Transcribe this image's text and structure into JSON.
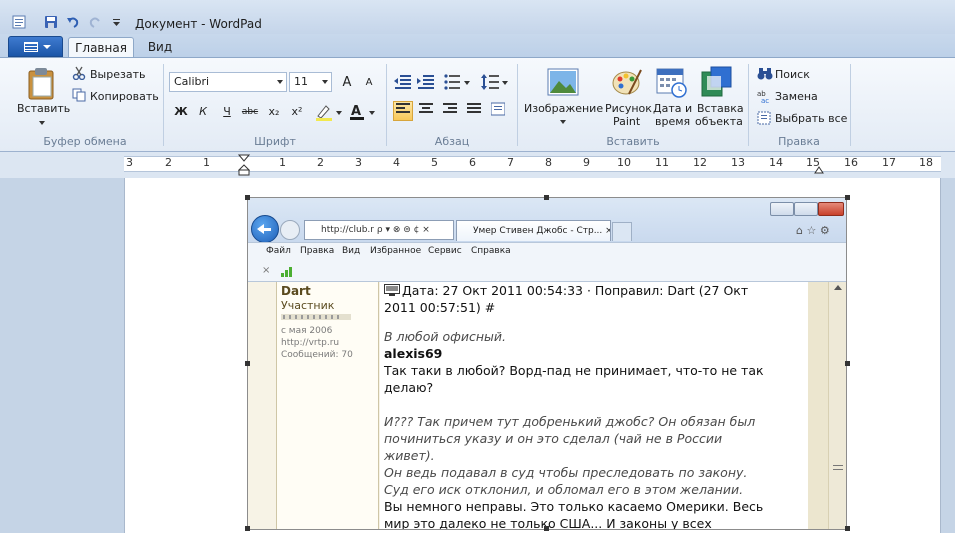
{
  "window": {
    "title": "Документ - WordPad"
  },
  "tabs": [
    {
      "label": "Главная"
    },
    {
      "label": "Вид"
    }
  ],
  "clipboard": {
    "paste": "Вставить",
    "cut": "Вырезать",
    "copy": "Копировать",
    "group": "Буфер обмена"
  },
  "font": {
    "family": "Calibri",
    "size": "11",
    "group": "Шрифт",
    "bold": "Ж",
    "italic": "К",
    "underline": "Ч",
    "strike": "abc",
    "sub": "x₂",
    "sup": "x²"
  },
  "paragraph": {
    "group": "Абзац"
  },
  "insert": {
    "image": "Изображение",
    "paint_line1": "Рисунок",
    "paint_line2": "Paint",
    "datetime_line1": "Дата и",
    "datetime_line2": "время",
    "object_line1": "Вставка",
    "object_line2": "объекта",
    "group": "Вставить"
  },
  "editing": {
    "find": "Поиск",
    "replace": "Замена",
    "select_all": "Выбрать все",
    "group": "Правка"
  },
  "ruler": {
    "labels": [
      "3",
      "2",
      "1",
      "1",
      "2",
      "3",
      "4",
      "5",
      "6",
      "7",
      "8",
      "9",
      "10",
      "11",
      "12",
      "13",
      "14",
      "15",
      "16",
      "17",
      "18"
    ]
  },
  "browser": {
    "address": "http://club.r",
    "tab_title": "Умер Стивен Джобс - Стр...",
    "menu": [
      "Файл",
      "Правка",
      "Вид",
      "Избранное",
      "Сервис",
      "Справка"
    ]
  },
  "forum": {
    "user_name": "Dart",
    "user_rank": "Участник",
    "user_since": "с мая 2006",
    "user_site": "http://vrtp.ru",
    "user_posts": "Сообщений: 70",
    "post_header_1": "Дата: 27 Окт 2011 00:54:33 · Поправил: Dart (27 Окт",
    "post_header_2": "2011 00:57:51) #",
    "quote_1": "В любой офисный.",
    "quote_author": "alexis69",
    "reply_1": "Так таки в любой? Ворд-пад не принимает, что-то не так",
    "reply_2": "делаю?",
    "quote_2a": "И??? Так причем тут добренький джобс? Он обязан был",
    "quote_2b": "починиться указу и он это сделал (чай не в России",
    "quote_2c": "живет).",
    "quote_2d": "Он ведь подавал в суд чтобы преследовать по закону.",
    "quote_2e": "Суд его иск отклонил, и обломал его в этом желании.",
    "reply_3a": "Вы немного неправы. Это только касаемо Омерики. Весь",
    "reply_3b": "мир это далеко не только США... И законы у всех"
  }
}
